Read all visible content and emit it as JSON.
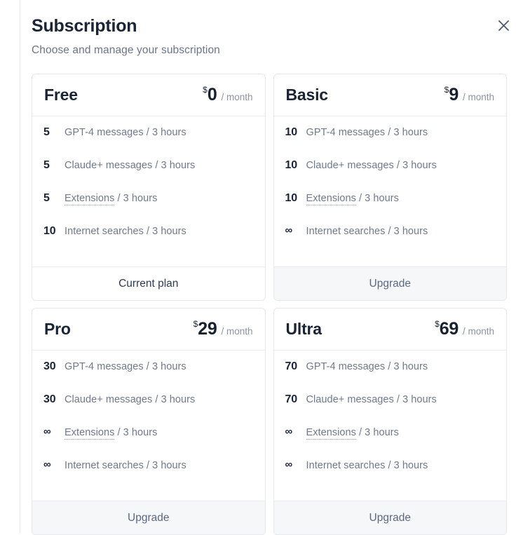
{
  "dialog": {
    "title": "Subscription",
    "subtitle": "Choose and manage your subscription",
    "close_icon": "close-icon"
  },
  "plans": [
    {
      "name": "Free",
      "currency": "$",
      "amount": "0",
      "period": "/ month",
      "features": [
        {
          "value": "5",
          "label": "GPT-4 messages / 3 hours",
          "dotted_term": ""
        },
        {
          "value": "5",
          "label": "Claude+ messages / 3 hours",
          "dotted_term": ""
        },
        {
          "value": "5",
          "label": " / 3 hours",
          "dotted_term": "Extensions"
        },
        {
          "value": "10",
          "label": "Internet searches / 3 hours",
          "dotted_term": ""
        }
      ],
      "action_label": "Current plan",
      "action_state": "current"
    },
    {
      "name": "Basic",
      "currency": "$",
      "amount": "9",
      "period": "/ month",
      "features": [
        {
          "value": "10",
          "label": "GPT-4 messages / 3 hours",
          "dotted_term": ""
        },
        {
          "value": "10",
          "label": "Claude+ messages / 3 hours",
          "dotted_term": ""
        },
        {
          "value": "10",
          "label": " / 3 hours",
          "dotted_term": "Extensions"
        },
        {
          "value": "∞",
          "label": "Internet searches / 3 hours",
          "dotted_term": ""
        }
      ],
      "action_label": "Upgrade",
      "action_state": "upgrade"
    },
    {
      "name": "Pro",
      "currency": "$",
      "amount": "29",
      "period": "/ month",
      "features": [
        {
          "value": "30",
          "label": "GPT-4 messages / 3 hours",
          "dotted_term": ""
        },
        {
          "value": "30",
          "label": "Claude+ messages / 3 hours",
          "dotted_term": ""
        },
        {
          "value": "∞",
          "label": " / 3 hours",
          "dotted_term": "Extensions"
        },
        {
          "value": "∞",
          "label": "Internet searches / 3 hours",
          "dotted_term": ""
        }
      ],
      "action_label": "Upgrade",
      "action_state": "upgrade"
    },
    {
      "name": "Ultra",
      "currency": "$",
      "amount": "69",
      "period": "/ month",
      "features": [
        {
          "value": "70",
          "label": "GPT-4 messages / 3 hours",
          "dotted_term": ""
        },
        {
          "value": "70",
          "label": "Claude+ messages / 3 hours",
          "dotted_term": ""
        },
        {
          "value": "∞",
          "label": " / 3 hours",
          "dotted_term": "Extensions"
        },
        {
          "value": "∞",
          "label": "Internet searches / 3 hours",
          "dotted_term": ""
        }
      ],
      "action_label": "Upgrade",
      "action_state": "upgrade"
    }
  ],
  "colors": {
    "heading": "#1b2435",
    "muted": "#6f7989",
    "border": "#e6e7ea",
    "footer_bg": "#f6f7f8",
    "footer_text": "#5a6880",
    "current_text": "#2e3b52"
  }
}
